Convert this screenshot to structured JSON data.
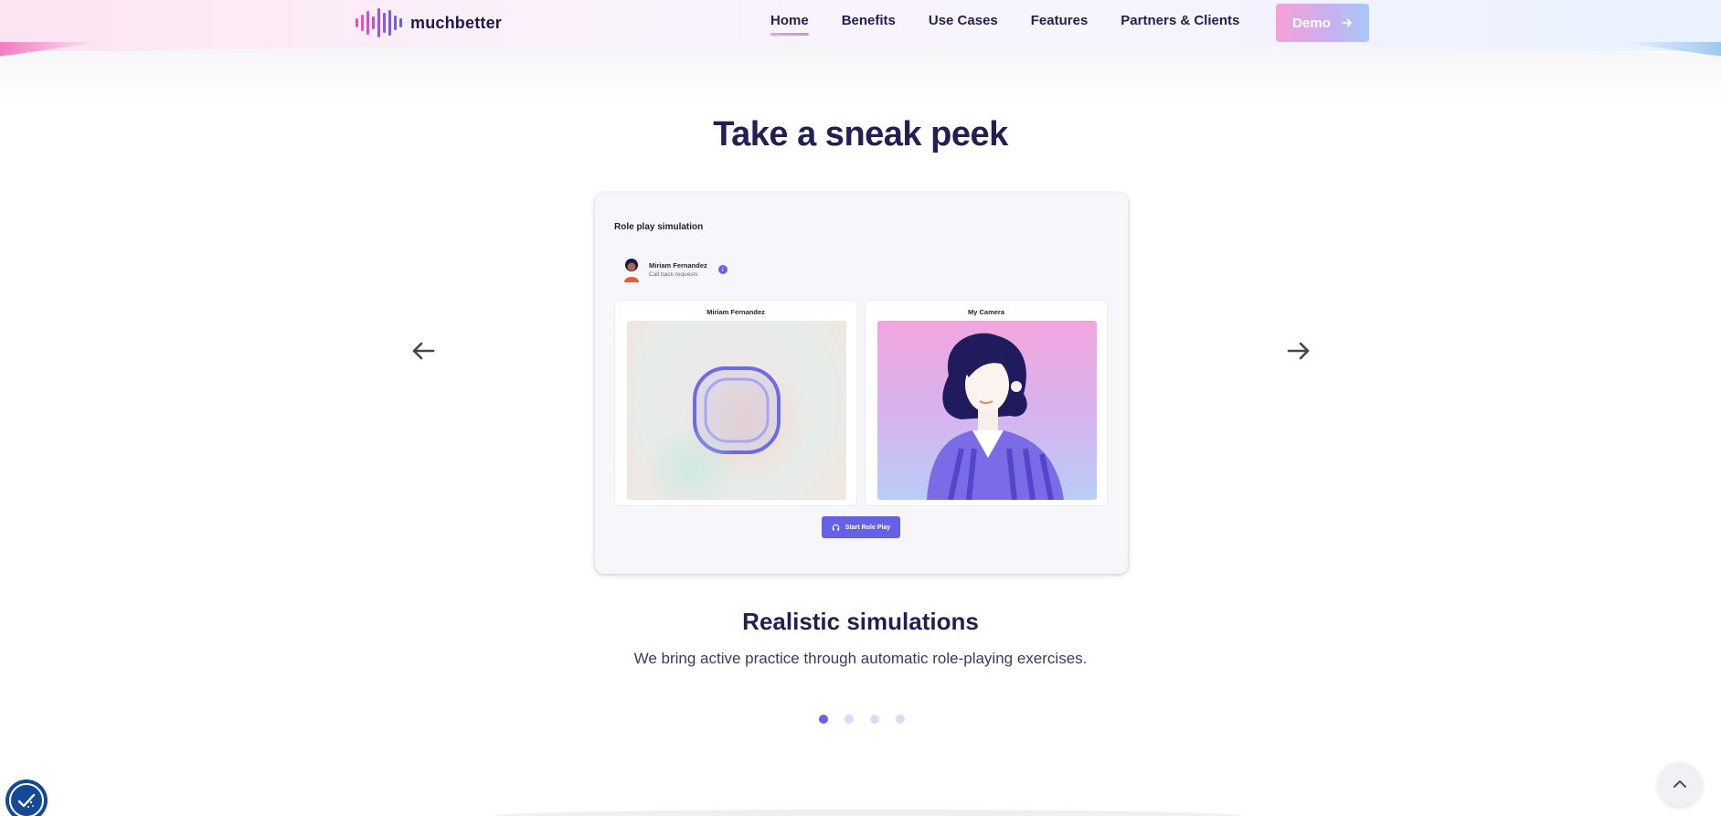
{
  "brand": {
    "name": "muchbetter",
    "logo_colors": [
      "#f050b4",
      "#c14fd6",
      "#8a56e8",
      "#5b63ec"
    ]
  },
  "nav": {
    "items": [
      {
        "label": "Home",
        "active": true
      },
      {
        "label": "Benefits",
        "active": false
      },
      {
        "label": "Use Cases",
        "active": false
      },
      {
        "label": "Features",
        "active": false
      },
      {
        "label": "Partners & Clients",
        "active": false
      }
    ],
    "demo_label": "Demo",
    "demo_icon": "arrow-right-icon"
  },
  "section": {
    "title": "Take a sneak peek"
  },
  "carousel": {
    "prev_icon": "arrow-left-icon",
    "next_icon": "arrow-right-icon",
    "slide": {
      "screen_title": "Role play simulation",
      "persona_name": "Miriam Fernandez",
      "persona_subtitle": "Call back requests",
      "left_panel_label": "Miriam Fernandez",
      "right_panel_label": "My Camera",
      "start_button_label": "Start Role Play",
      "heading": "Realistic simulations",
      "description": "We bring active practice through automatic role-playing exercises."
    },
    "dots": [
      {
        "active": true
      },
      {
        "active": false
      },
      {
        "active": false
      },
      {
        "active": false
      }
    ]
  },
  "colors": {
    "accent": "#6a62e6",
    "title": "#221f52",
    "demo_gradient_start": "#f5a0d6",
    "demo_gradient_end": "#a9c8f5",
    "cookie_button": "#144a93"
  },
  "floating": {
    "cookie_icon": "cookie-consent-icon",
    "scroll_top_icon": "chevron-up-icon"
  }
}
